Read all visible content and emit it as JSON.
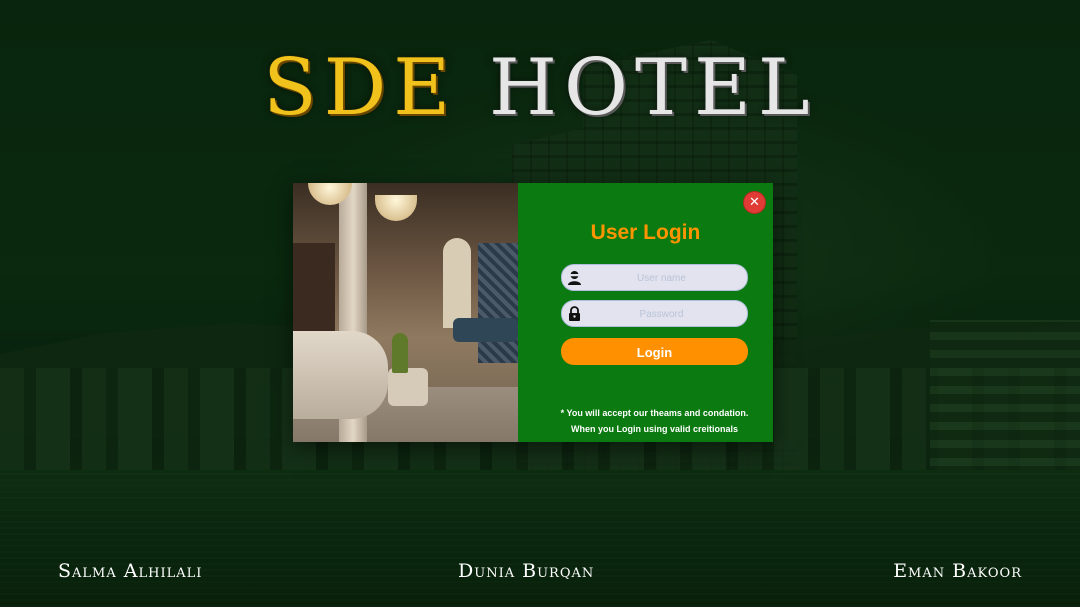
{
  "header": {
    "title_part1": "SDE",
    "title_part2": "HOTEL",
    "title_part1_color": "#f1c21b",
    "title_part2_color": "#e6e6e6"
  },
  "login_dialog": {
    "close_icon": "close-icon",
    "title": "User Login",
    "username_placeholder": "User name",
    "username_icon": "user-icon",
    "password_placeholder": "Password",
    "password_icon": "lock-icon",
    "login_label": "Login",
    "terms_line1": "* You will accept our theams and condation.",
    "terms_line2": "When you Login using valid creitionals",
    "panel_color": "#0b7a10",
    "accent_color": "#ff9000",
    "close_color": "#e03c35"
  },
  "footer": {
    "names": [
      "Salma Alhilali",
      "Dunia Burqan",
      "Eman Bakoor"
    ]
  }
}
